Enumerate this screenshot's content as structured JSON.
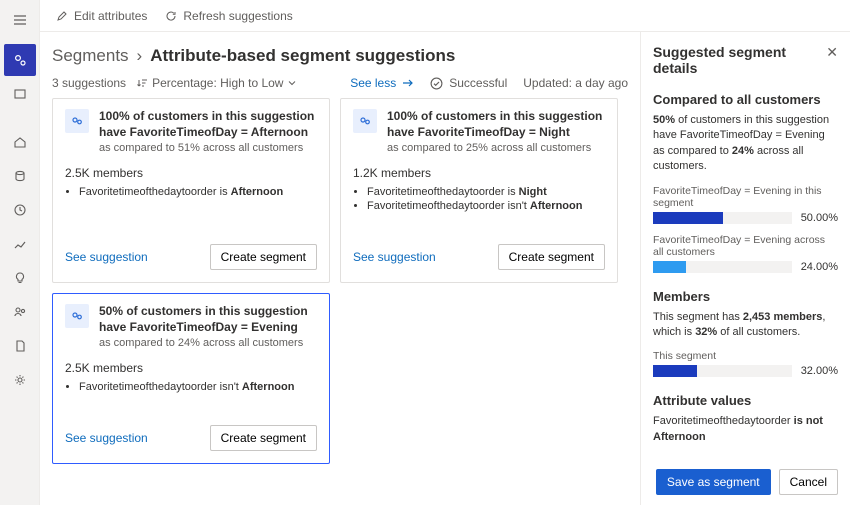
{
  "topbar": {
    "edit": "Edit attributes",
    "refresh": "Refresh suggestions"
  },
  "breadcrumb": {
    "root": "Segments",
    "sep": "›",
    "page": "Attribute-based segment suggestions"
  },
  "metabar": {
    "count": "3 suggestions",
    "sort_label": "Percentage: High to Low",
    "see_less": "See less",
    "status": "Successful",
    "updated": "Updated: a day ago"
  },
  "card_common": {
    "see_suggestion": "See suggestion",
    "create_segment": "Create segment"
  },
  "cards": [
    {
      "title": "100% of customers in this suggestion have FavoriteTimeofDay = Afternoon",
      "subtitle": "as compared to 51% across all customers",
      "members": "2.5K members",
      "rules": [
        {
          "attr": "Favoritetimeofthedaytoorder is ",
          "val": "Afternoon"
        }
      ],
      "selected": false
    },
    {
      "title": "100% of customers in this suggestion have FavoriteTimeofDay = Night",
      "subtitle": "as compared to 25% across all customers",
      "members": "1.2K members",
      "rules": [
        {
          "attr": "Favoritetimeofthedaytoorder is ",
          "val": "Night"
        },
        {
          "attr": "Favoritetimeofthedaytoorder isn't ",
          "val": "Afternoon"
        }
      ],
      "selected": false
    },
    {
      "title": "50% of customers in this suggestion have FavoriteTimeofDay = Evening",
      "subtitle": "as compared to 24% across all customers",
      "members": "2.5K members",
      "rules": [
        {
          "attr": "Favoritetimeofthedaytoorder isn't ",
          "val": "Afternoon"
        }
      ],
      "selected": true
    }
  ],
  "sidepanel": {
    "title": "Suggested segment details",
    "section_compare": "Compared to all customers",
    "compare_text_a": "50%",
    "compare_text_b": " of customers in this suggestion have FavoriteTimeofDay = Evening as compared to ",
    "compare_text_c": "24%",
    "compare_text_d": " across all customers.",
    "bar1_label": "FavoriteTimeofDay = Evening in this segment",
    "bar1_val": "50.00%",
    "bar1_pct": 50,
    "bar1_color": "#1b3bbd",
    "bar2_label": "FavoriteTimeofDay = Evening across all customers",
    "bar2_val": "24.00%",
    "bar2_pct": 24,
    "bar2_color": "#2e9bf0",
    "section_members": "Members",
    "members_text_a": "This segment has ",
    "members_text_b": "2,453 members",
    "members_text_c": ", which is ",
    "members_text_d": "32%",
    "members_text_e": " of all customers.",
    "bar3_label": "This segment",
    "bar3_val": "32.00%",
    "bar3_pct": 32,
    "bar3_color": "#1b3bbd",
    "section_attr": "Attribute values",
    "attr_text_a": "Favoritetimeofthedaytoorder ",
    "attr_text_b": "is not Afternoon",
    "save": "Save as segment",
    "cancel": "Cancel"
  }
}
